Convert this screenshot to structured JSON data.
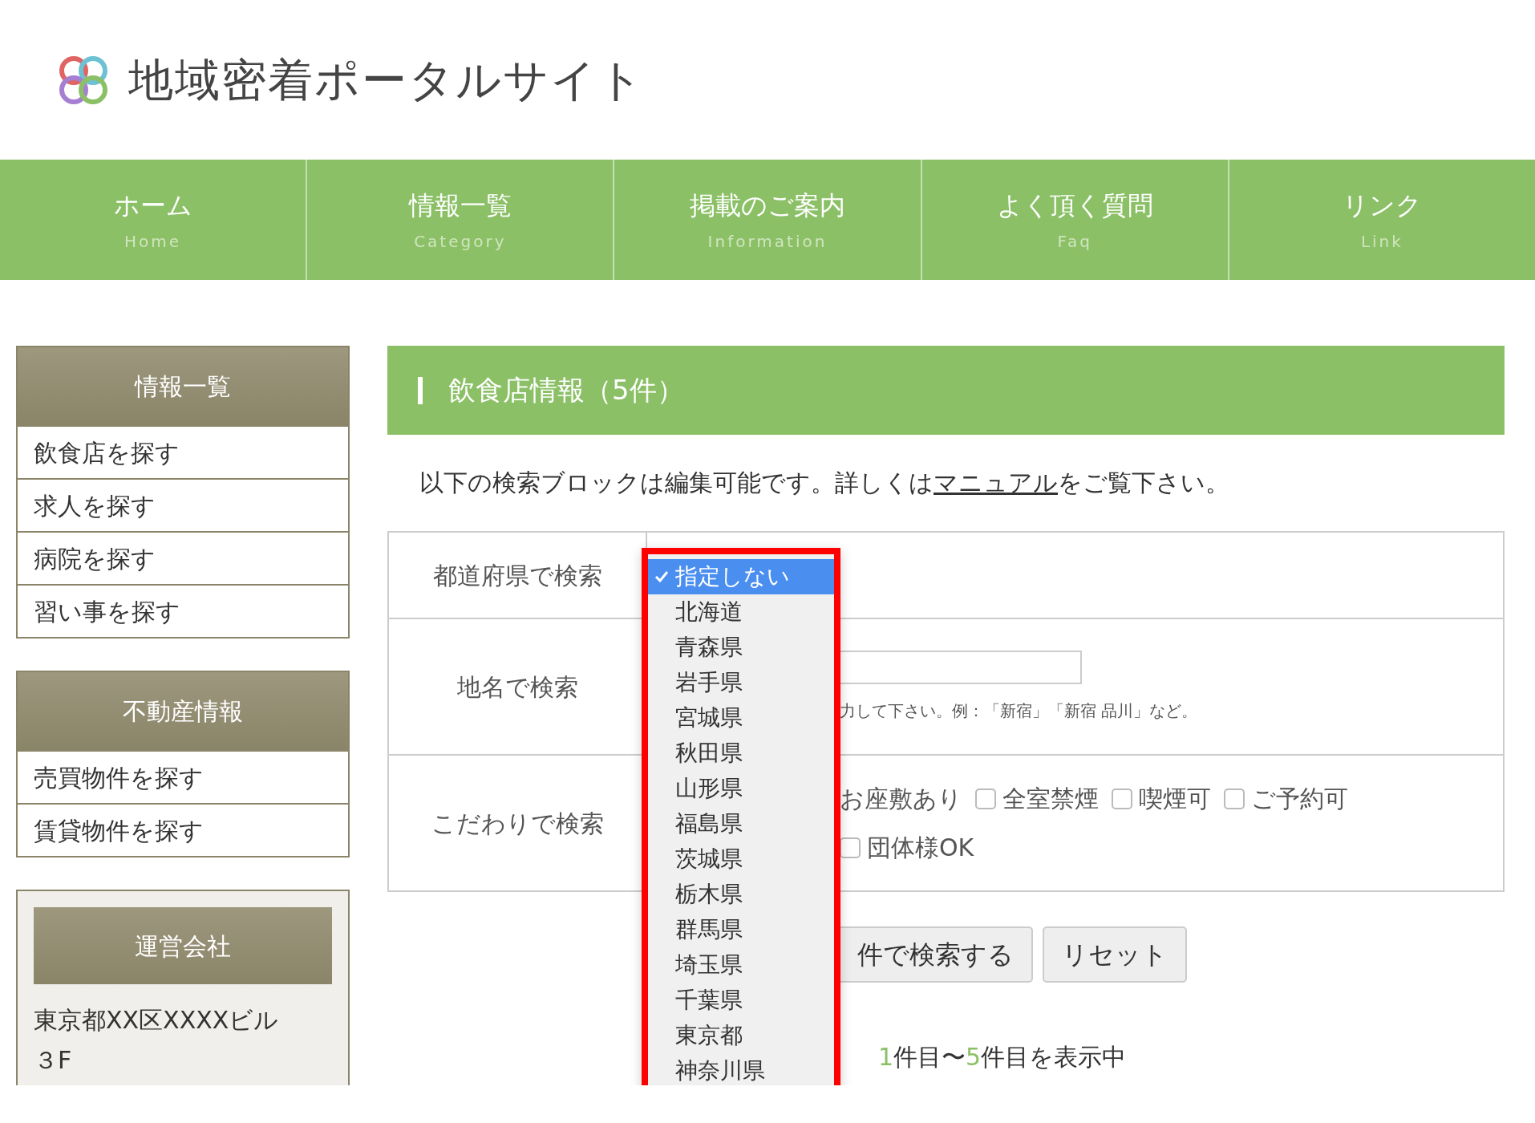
{
  "site": {
    "title": "地域密着ポータルサイト"
  },
  "nav": [
    {
      "label": "ホーム",
      "sub": "Home"
    },
    {
      "label": "情報一覧",
      "sub": "Category"
    },
    {
      "label": "掲載のご案内",
      "sub": "Information"
    },
    {
      "label": "よく頂く質問",
      "sub": "Faq"
    },
    {
      "label": "リンク",
      "sub": "Link"
    }
  ],
  "sidebar": {
    "sections": [
      {
        "title": "情報一覧",
        "items": [
          "飲食店を探す",
          "求人を探す",
          "病院を探す",
          "習い事を探す"
        ]
      },
      {
        "title": "不動産情報",
        "items": [
          "売買物件を探す",
          "賃貸物件を探す"
        ]
      }
    ],
    "company": {
      "title": "運営会社",
      "address": "東京都XX区XXXXビル３F"
    }
  },
  "main": {
    "heading": "飲食店情報（5件）",
    "intro": {
      "before": "以下の検索ブロックは編集可能です。詳しくは",
      "link": "マニュアル",
      "after": "をご覧下さい。"
    },
    "search_rows": [
      {
        "kind": "select",
        "label": "都道府県で検索"
      },
      {
        "kind": "text",
        "label": "地名で検索",
        "hint": "力して下さい。例：「新宿」「新宿 品川」など。"
      },
      {
        "kind": "checks",
        "label": "こだわりで検索",
        "lead": "お座敷あり",
        "options": [
          {
            "label": "全室禁煙",
            "checked": false
          },
          {
            "label": "喫煙可",
            "checked": false
          },
          {
            "label": "ご予約可",
            "checked": false
          },
          {
            "label": "団体様OK",
            "checked": false
          }
        ]
      }
    ],
    "buttons": [
      "件で検索する",
      "リセット"
    ],
    "result": [
      {
        "text": "1",
        "highlight": true
      },
      {
        "text": "件目〜",
        "highlight": false
      },
      {
        "text": "5",
        "highlight": true
      },
      {
        "text": "件目を表示中",
        "highlight": false
      }
    ],
    "prefecture_dropdown": {
      "options": [
        {
          "label": "指定しない",
          "selected": true
        },
        {
          "label": "北海道",
          "selected": false
        },
        {
          "label": "青森県",
          "selected": false
        },
        {
          "label": "岩手県",
          "selected": false
        },
        {
          "label": "宮城県",
          "selected": false
        },
        {
          "label": "秋田県",
          "selected": false
        },
        {
          "label": "山形県",
          "selected": false
        },
        {
          "label": "福島県",
          "selected": false
        },
        {
          "label": "茨城県",
          "selected": false
        },
        {
          "label": "栃木県",
          "selected": false
        },
        {
          "label": "群馬県",
          "selected": false
        },
        {
          "label": "埼玉県",
          "selected": false
        },
        {
          "label": "千葉県",
          "selected": false
        },
        {
          "label": "東京都",
          "selected": false
        },
        {
          "label": "神奈川県",
          "selected": false
        }
      ]
    }
  }
}
